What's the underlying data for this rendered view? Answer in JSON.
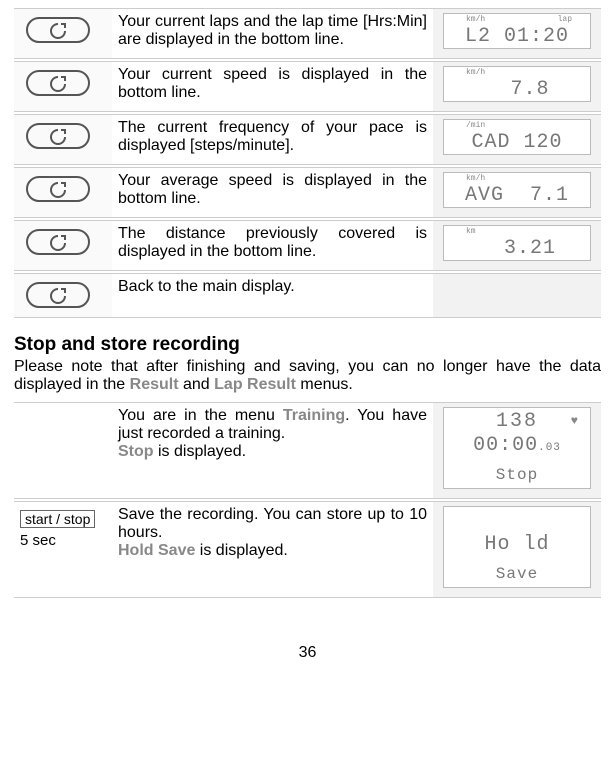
{
  "table1": {
    "rows": [
      {
        "desc": "Your current laps and the lap time [Hrs:Min] are displayed in the bottom line.",
        "lcd": {
          "tl": "km/h",
          "tr": "lap",
          "main": "L2 01:20"
        }
      },
      {
        "desc": "Your current speed is displayed in the bottom line.",
        "lcd": {
          "tl": "km/h",
          "tr": "",
          "main": "  7.8"
        }
      },
      {
        "desc": "The current frequency of your pace is displayed [steps/minute].",
        "lcd": {
          "tl": "/min",
          "tr": "",
          "main": "CAD 120"
        }
      },
      {
        "desc": "Your average speed is displayed in the bottom line.",
        "lcd": {
          "tl": "km/h",
          "tr": "",
          "main": "AVG  7.1"
        }
      },
      {
        "desc": "The distance previously covered is displayed in the bottom line.",
        "lcd": {
          "tl": "km",
          "tr": "",
          "main": "  3.21"
        }
      },
      {
        "desc": "Back to the main display.",
        "lcd": null
      }
    ]
  },
  "section": {
    "title": "Stop and store recording",
    "intro_a": "Please note that after finishing and saving, you can no longer have the data displayed in the ",
    "intro_b": "Result",
    "intro_c": " and ",
    "intro_d": "Lap Result",
    "intro_e": " menus."
  },
  "table2": {
    "rows": [
      {
        "left": null,
        "desc_a": "You are in the menu ",
        "desc_b": "Training",
        "desc_c": ". You have just recorded a training.",
        "desc2a": "Stop",
        "desc2b": " is displayed.",
        "lcd": {
          "l1": "138",
          "l2": "00:00",
          "l2sub": ".03",
          "l3": "Stop",
          "heart": "♥"
        }
      },
      {
        "left_btn": "start / stop",
        "left_sub": "5 sec",
        "desc_a": "Save the recording. You can store up to 10 hours.",
        "desc2a": "Hold Save",
        "desc2b": " is displayed.",
        "lcd": {
          "l2": "Ho ld",
          "l3": "Save"
        }
      }
    ]
  },
  "pagenum": "36"
}
